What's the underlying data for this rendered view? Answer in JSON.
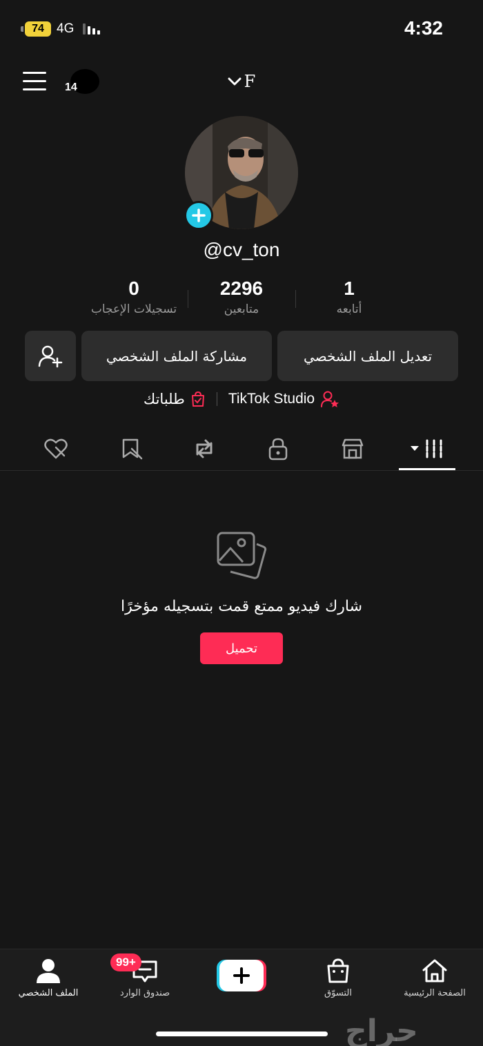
{
  "status_bar": {
    "battery": "74",
    "network": "4G",
    "time": "4:32"
  },
  "header": {
    "notification_count": "14",
    "account_name": "F"
  },
  "profile": {
    "username": "@cv_ton"
  },
  "stats": [
    {
      "value": "1",
      "label": "أتابعه"
    },
    {
      "value": "2296",
      "label": "متابعين"
    },
    {
      "value": "0",
      "label": "تسجيلات الإعجاب"
    }
  ],
  "actions": {
    "edit_profile": "تعديل الملف الشخصي",
    "share_profile": "مشاركة الملف الشخصي"
  },
  "links": {
    "studio": "TikTok Studio",
    "orders": "طلباتك"
  },
  "tabs": [
    "videos",
    "shop",
    "private",
    "reposts",
    "favorites",
    "liked"
  ],
  "empty_state": {
    "message": "شارك فيديو ممتع قمت بتسجيله مؤخرًا",
    "upload_label": "تحميل"
  },
  "bottom_nav": {
    "home": "الصفحة الرئيسية",
    "shop": "التسوّق",
    "inbox": "صندوق الوارد",
    "inbox_badge": "99+",
    "profile": "الملف الشخصي"
  },
  "watermark": "حراج",
  "colors": {
    "accent": "#fe2c55",
    "cyan": "#24c8e6",
    "background": "#161616",
    "battery": "#f2d23a"
  }
}
